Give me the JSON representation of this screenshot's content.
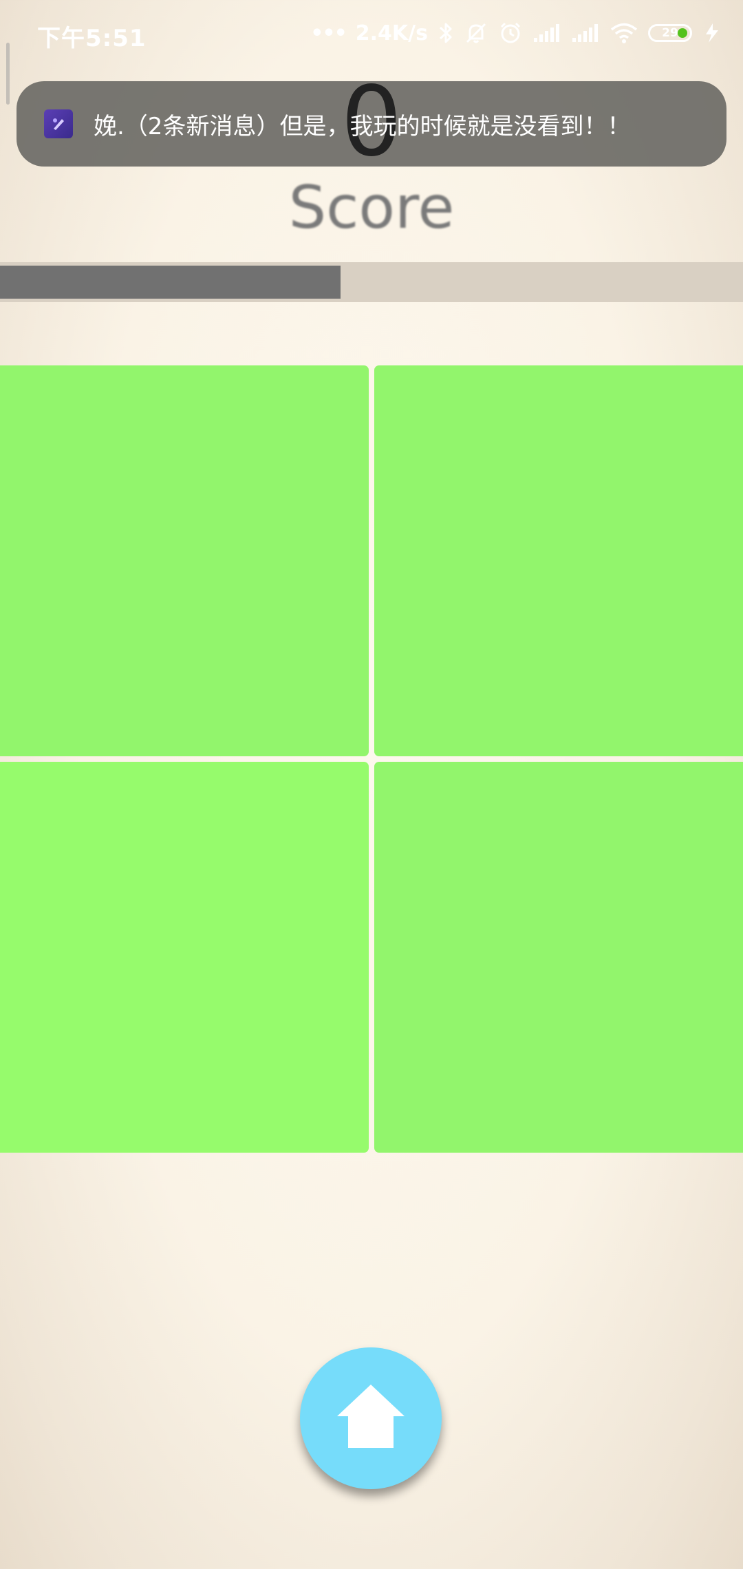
{
  "status_bar": {
    "time": "下午5:51",
    "dots": "•••",
    "network_speed": "2.4K/s",
    "battery_level": "29",
    "icons": [
      "bluetooth-icon",
      "mute-bell-icon",
      "alarm-icon",
      "signal-icon",
      "signal-icon",
      "wifi-icon",
      "battery-icon",
      "charging-icon"
    ]
  },
  "notification": {
    "icon": "app-icon",
    "text": "娩.（2条新消息）但是，我玩的时候就是没看到！！"
  },
  "game": {
    "score": "0",
    "score_label": "Score",
    "timer_fraction": 0.458,
    "tile_color": "#92f56c",
    "tiles": [
      "tile-1",
      "tile-2",
      "tile-3",
      "tile-4"
    ]
  },
  "home_button": {
    "icon": "home-icon",
    "color": "#76dcfa"
  }
}
